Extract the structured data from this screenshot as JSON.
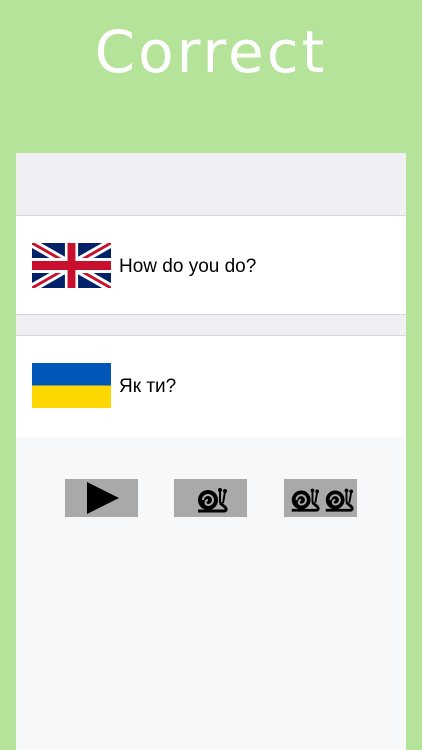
{
  "header": {
    "title": "Correct"
  },
  "phrases": {
    "source": {
      "flag": "uk-flag-icon",
      "text": "How do you do?"
    },
    "target": {
      "flag": "ukraine-flag-icon",
      "text": "Як ти?"
    }
  },
  "controls": {
    "play": {
      "icon": "play-icon"
    },
    "slow": {
      "icon": "snail-icon"
    },
    "slower": {
      "icon": "two-snails-icon"
    }
  },
  "colors": {
    "background": "#b6e39a",
    "button": "#a9a9a9",
    "ukraine_blue": "#0057b7",
    "ukraine_yellow": "#ffd700",
    "uk_blue": "#012169",
    "uk_red": "#c8102e"
  }
}
